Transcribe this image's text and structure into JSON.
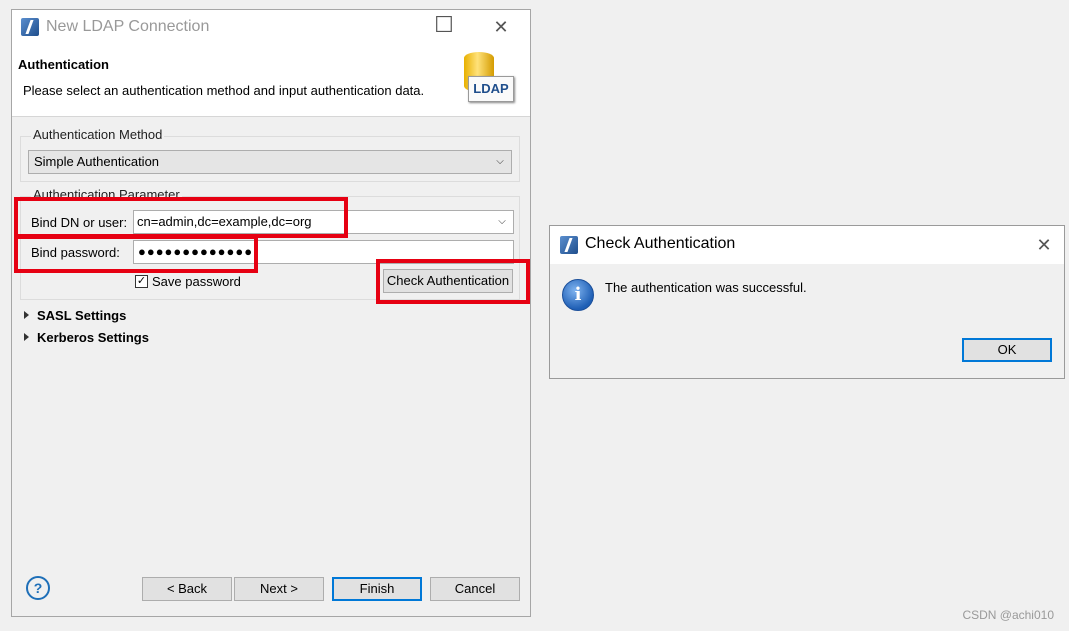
{
  "wizard": {
    "title": "New LDAP Connection",
    "banner_title": "Authentication",
    "banner_desc": "Please select an authentication method and input authentication data.",
    "logo_text": "LDAP",
    "auth_method_group": "Authentication Method",
    "auth_method_value": "Simple Authentication",
    "auth_param_group": "Authentication Parameter",
    "bind_dn_label": "Bind DN or user:",
    "bind_dn_value": "cn=admin,dc=example,dc=org",
    "bind_password_label": "Bind password:",
    "bind_password_value": "●●●●●●●●●●●●●",
    "save_password_label": "Save password",
    "save_password_checked": true,
    "check_auth_button": "Check Authentication",
    "sasl_section": "SASL Settings",
    "kerberos_section": "Kerberos Settings",
    "back_button": "< Back",
    "next_button": "Next >",
    "finish_button": "Finish",
    "cancel_button": "Cancel"
  },
  "dialog": {
    "title": "Check Authentication",
    "message": "The authentication was successful.",
    "ok_button": "OK"
  },
  "watermark": "CSDN @achi010",
  "colors": {
    "highlight_red": "#e60012",
    "accent_blue": "#0078d7"
  },
  "icons": [
    "app-icon",
    "ldap-logo-icon",
    "help-icon",
    "info-icon",
    "close-icon",
    "maximize-icon",
    "minimize-icon",
    "chevron-down-icon",
    "expand-triangle-icon"
  ]
}
